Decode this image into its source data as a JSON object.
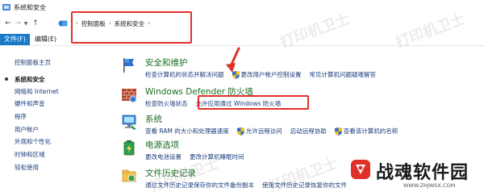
{
  "window": {
    "title": "系统和安全"
  },
  "address": {
    "crumbs": [
      "控制面板",
      "系统和安全"
    ]
  },
  "menu": {
    "file": "文件(F)",
    "edit": "编辑(E)"
  },
  "sidebar": {
    "items": [
      {
        "label": "控制面板主页",
        "type": "link"
      },
      {
        "label": "系统和安全",
        "type": "current"
      },
      {
        "label": "网络和 Internet",
        "type": "link"
      },
      {
        "label": "硬件和声音",
        "type": "link"
      },
      {
        "label": "程序",
        "type": "link"
      },
      {
        "label": "用户帐户",
        "type": "link"
      },
      {
        "label": "外观和个性化",
        "type": "link"
      },
      {
        "label": "时钟和区域",
        "type": "link"
      },
      {
        "label": "轻松使用",
        "type": "link"
      }
    ]
  },
  "categories": {
    "security": {
      "title": "安全和维护",
      "links": [
        "检查计算机的状态并解决问题",
        "更改用户帐户控制设置",
        "常见计算机问题疑难解答"
      ]
    },
    "firewall": {
      "title": "Windows Defender 防火墙",
      "links": [
        "检查防火墙状态",
        "允许应用通过 Windows 防火墙"
      ]
    },
    "system": {
      "title": "系统",
      "links": [
        "查看 RAM 的大小和处理器速度",
        "允许远程访问",
        "启动远程协助",
        "查看该计算机的名称"
      ]
    },
    "power": {
      "title": "电源选项",
      "links": [
        "更改电池设置",
        "更改计算机睡眠时间"
      ]
    },
    "history": {
      "title": "文件历史记录",
      "links": [
        "通过文件历史记录保存你的文件备份副本",
        "使用文件历史记录恢复你的文件"
      ]
    }
  },
  "watermark": "打印机卫士",
  "brand": {
    "name": "战魂软件园",
    "url": "WWW.ZHJWSX.COM"
  },
  "colors": {
    "accent": "#1979ca",
    "highlight": "#e0302a",
    "category_title": "#1b6e21",
    "link": "#1a3d7c"
  }
}
